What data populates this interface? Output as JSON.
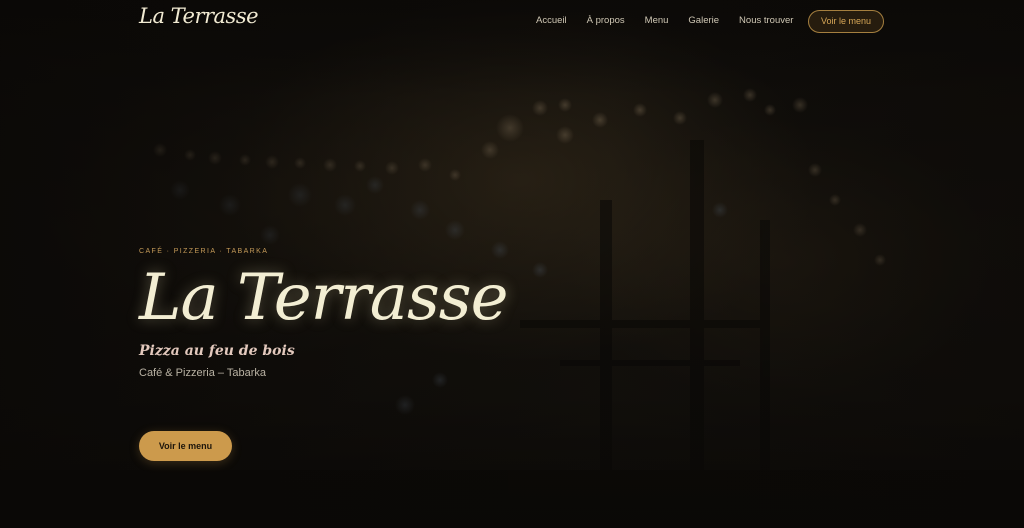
{
  "nav": {
    "logo": "La Terrasse",
    "links": [
      "Accueil",
      "À propos",
      "Menu",
      "Galerie",
      "Nous trouver"
    ],
    "cta_label": "Voir le menu"
  },
  "hero": {
    "eyebrow": "CAFÉ · PIZZERIA · TABARKA",
    "title": "La Terrasse",
    "tagline": "Pizza au feu de bois",
    "subtitle": "Café & Pizzeria – Tabarka",
    "cta_label": "Voir le menu"
  },
  "colors": {
    "accent": "#cc9a4c",
    "accent_text": "#d7a757",
    "title": "#f3eed3",
    "background": "#0d0b08"
  }
}
